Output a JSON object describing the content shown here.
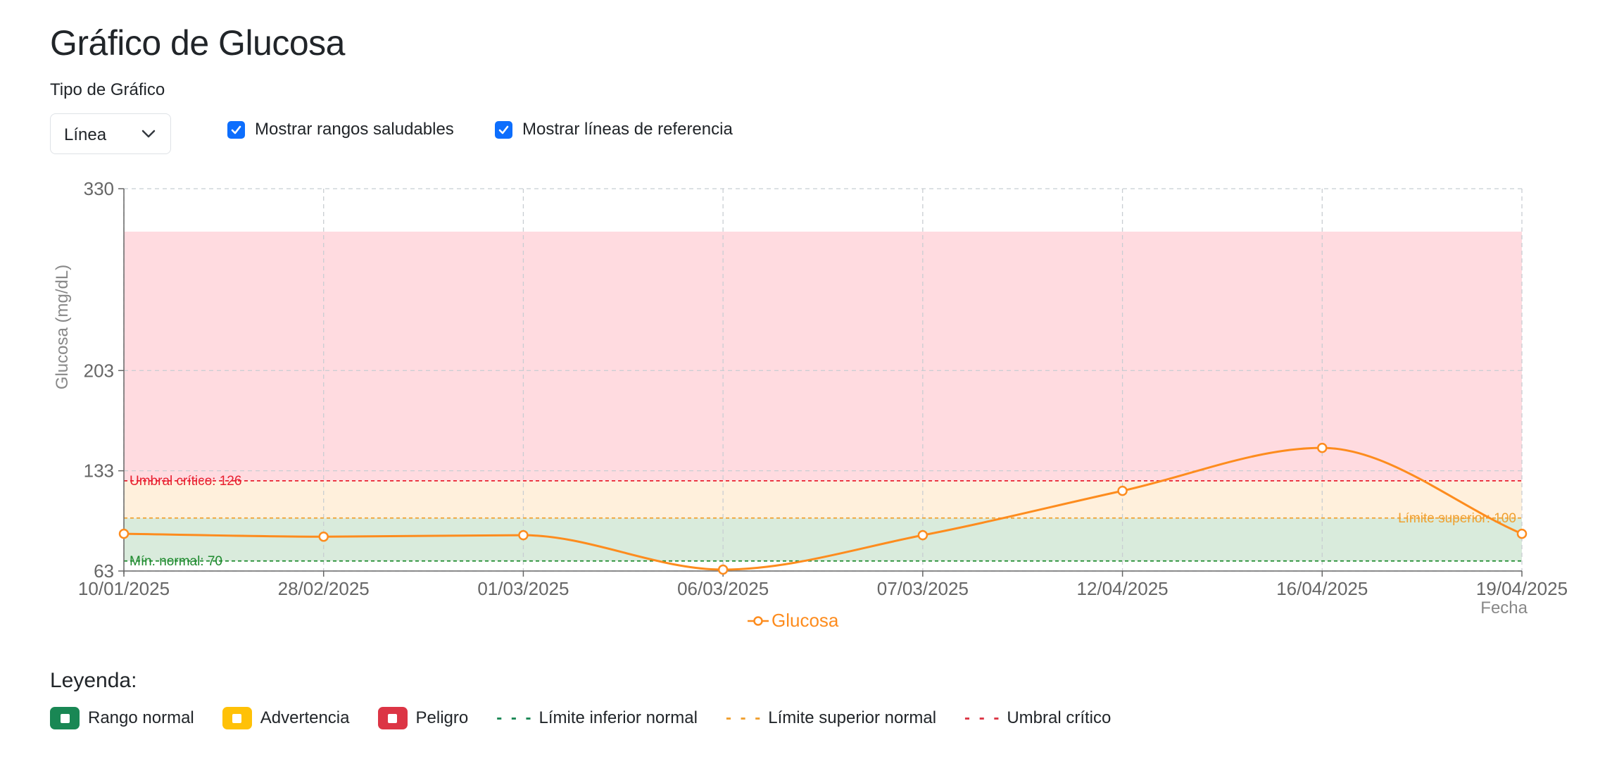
{
  "page": {
    "title": "Gráfico de Glucosa",
    "type_label": "Tipo de Gráfico",
    "chart_type_value": "Línea",
    "checkbox_ranges": {
      "label": "Mostrar rangos saludables",
      "checked": true
    },
    "checkbox_refs": {
      "label": "Mostrar líneas de referencia",
      "checked": true
    },
    "accent_color": "#0d6efd"
  },
  "chart_data": {
    "type": "line",
    "title": "",
    "xlabel": "Fecha",
    "ylabel": "Glucosa (mg/dL)",
    "ylim": [
      63,
      330
    ],
    "yticks": [
      63,
      133,
      203,
      330
    ],
    "categories": [
      "10/01/2025",
      "28/02/2025",
      "01/03/2025",
      "06/03/2025",
      "07/03/2025",
      "12/04/2025",
      "16/04/2025",
      "19/04/2025"
    ],
    "series": [
      {
        "name": "Glucosa",
        "color": "#fd8c1e",
        "values": [
          89,
          87,
          88,
          64,
          88,
          119,
          149,
          89
        ]
      }
    ],
    "bands": [
      {
        "from": 70,
        "to": 100,
        "color": "#d9ebdc"
      },
      {
        "from": 100,
        "to": 126,
        "color": "#fff0dc"
      },
      {
        "from": 126,
        "to": 300,
        "color": "#ffdbe0"
      }
    ],
    "reference_lines": [
      {
        "value": 126,
        "label": "Umbral crítico: 126",
        "color": "#e8202f",
        "label_side": "left"
      },
      {
        "value": 100,
        "label": "Límite superior: 100",
        "color": "#f0a030",
        "label_side": "right"
      },
      {
        "value": 70,
        "label": "Mín. normal: 70",
        "color": "#1e8a2e",
        "label_side": "left"
      }
    ],
    "grid": true,
    "legend_position": "bottom-center"
  },
  "legend": {
    "title": "Leyenda:",
    "items": [
      {
        "label": "Rango normal",
        "color": "#198754",
        "kind": "swatch"
      },
      {
        "label": "Advertencia",
        "color": "#ffc107",
        "kind": "swatch"
      },
      {
        "label": "Peligro",
        "color": "#dc3545",
        "kind": "swatch"
      },
      {
        "label": "Límite inferior normal",
        "color": "#198754",
        "kind": "dash"
      },
      {
        "label": "Límite superior normal",
        "color": "#f0a030",
        "kind": "dash"
      },
      {
        "label": "Umbral crítico",
        "color": "#dc3545",
        "kind": "dash"
      }
    ]
  }
}
